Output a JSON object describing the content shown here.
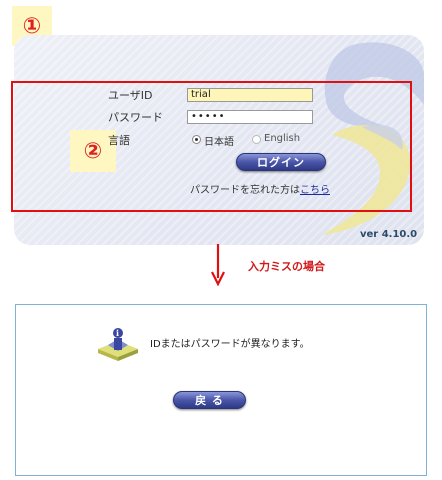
{
  "badges": {
    "one": "①",
    "two": "②"
  },
  "login": {
    "user_id_label": "ユーザID",
    "user_id_value": "trial",
    "password_label": "パスワード",
    "password_value": "•••••",
    "language_label": "言語",
    "lang_ja": "日本語",
    "lang_en": "English",
    "lang_selected": "日本語",
    "login_button": "ログイン",
    "forgot_text": "パスワードを忘れた方は",
    "forgot_link": "こちら",
    "version": "ver 4.10.0"
  },
  "caption": "入力ミスの場合",
  "error": {
    "message": "IDまたはパスワードが異なります。",
    "back_button": "戻 る"
  },
  "colors": {
    "highlight": "#e01010",
    "button": "#3a4698",
    "id_field_bg": "#fdf6b8",
    "caption": "#d01818"
  }
}
